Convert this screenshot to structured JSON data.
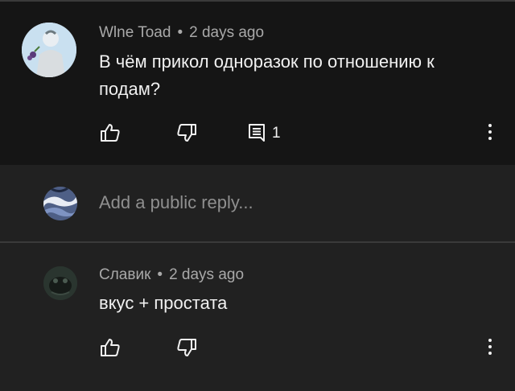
{
  "comments": [
    {
      "author": "Wlne Toad",
      "time": "2 days ago",
      "text": "В чём прикол одноразок по отношению к подам?",
      "reply_count": "1"
    },
    {
      "author": "Славик",
      "time": "2 days ago",
      "text": "вкус + простата"
    }
  ],
  "reply_box": {
    "placeholder": "Add a public reply..."
  },
  "icons": {
    "like": "thumbs-up-icon",
    "dislike": "thumbs-down-icon",
    "replies": "comment-icon",
    "more": "more-vert-icon"
  }
}
